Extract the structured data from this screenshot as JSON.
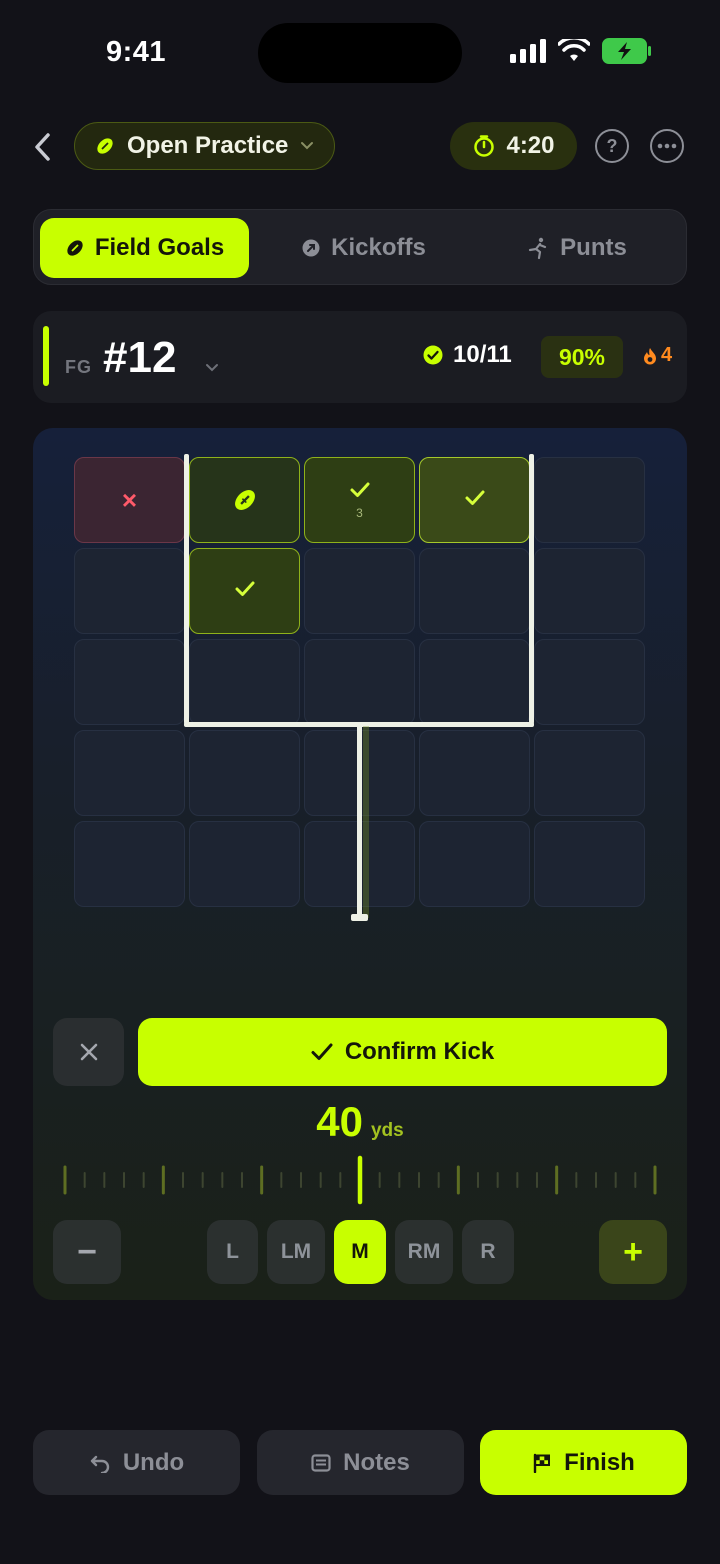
{
  "status": {
    "time": "9:41"
  },
  "header": {
    "mode_label": "Open Practice",
    "timer": "4:20",
    "help_icon": "question-circle-icon",
    "more_icon": "ellipsis-circle-icon"
  },
  "tabs": [
    {
      "label": "Field Goals",
      "icon": "football-icon",
      "active": true
    },
    {
      "label": "Kickoffs",
      "icon": "kickoff-icon",
      "active": false
    },
    {
      "label": "Punts",
      "icon": "punt-icon",
      "active": false
    }
  ],
  "kick_info": {
    "type_label": "FG",
    "number": "#12",
    "made_count": "10/11",
    "percentage": "90%",
    "streak": "4"
  },
  "target_grid": {
    "marks": [
      {
        "row": 0,
        "col": 0,
        "result": "miss",
        "symbol": "×"
      },
      {
        "row": 0,
        "col": 1,
        "result": "current",
        "symbol": "football"
      },
      {
        "row": 0,
        "col": 2,
        "result": "made",
        "symbol": "✓",
        "count": "3"
      },
      {
        "row": 0,
        "col": 3,
        "result": "made",
        "symbol": "✓"
      },
      {
        "row": 1,
        "col": 1,
        "result": "made",
        "symbol": "✓"
      }
    ]
  },
  "controls": {
    "confirm_label": "Confirm Kick",
    "distance_value": "40",
    "distance_unit": "yds",
    "directions": [
      {
        "label": "L",
        "active": false
      },
      {
        "label": "LM",
        "active": false
      },
      {
        "label": "M",
        "active": true
      },
      {
        "label": "RM",
        "active": false
      },
      {
        "label": "R",
        "active": false
      }
    ],
    "minus_label": "−",
    "plus_label": "+"
  },
  "bottom": {
    "undo_label": "Undo",
    "notes_label": "Notes",
    "finish_label": "Finish"
  },
  "colors": {
    "accent": "#c8ff00",
    "background": "#121218",
    "miss": "#ff5a6a",
    "streak": "#ff8a1f"
  }
}
